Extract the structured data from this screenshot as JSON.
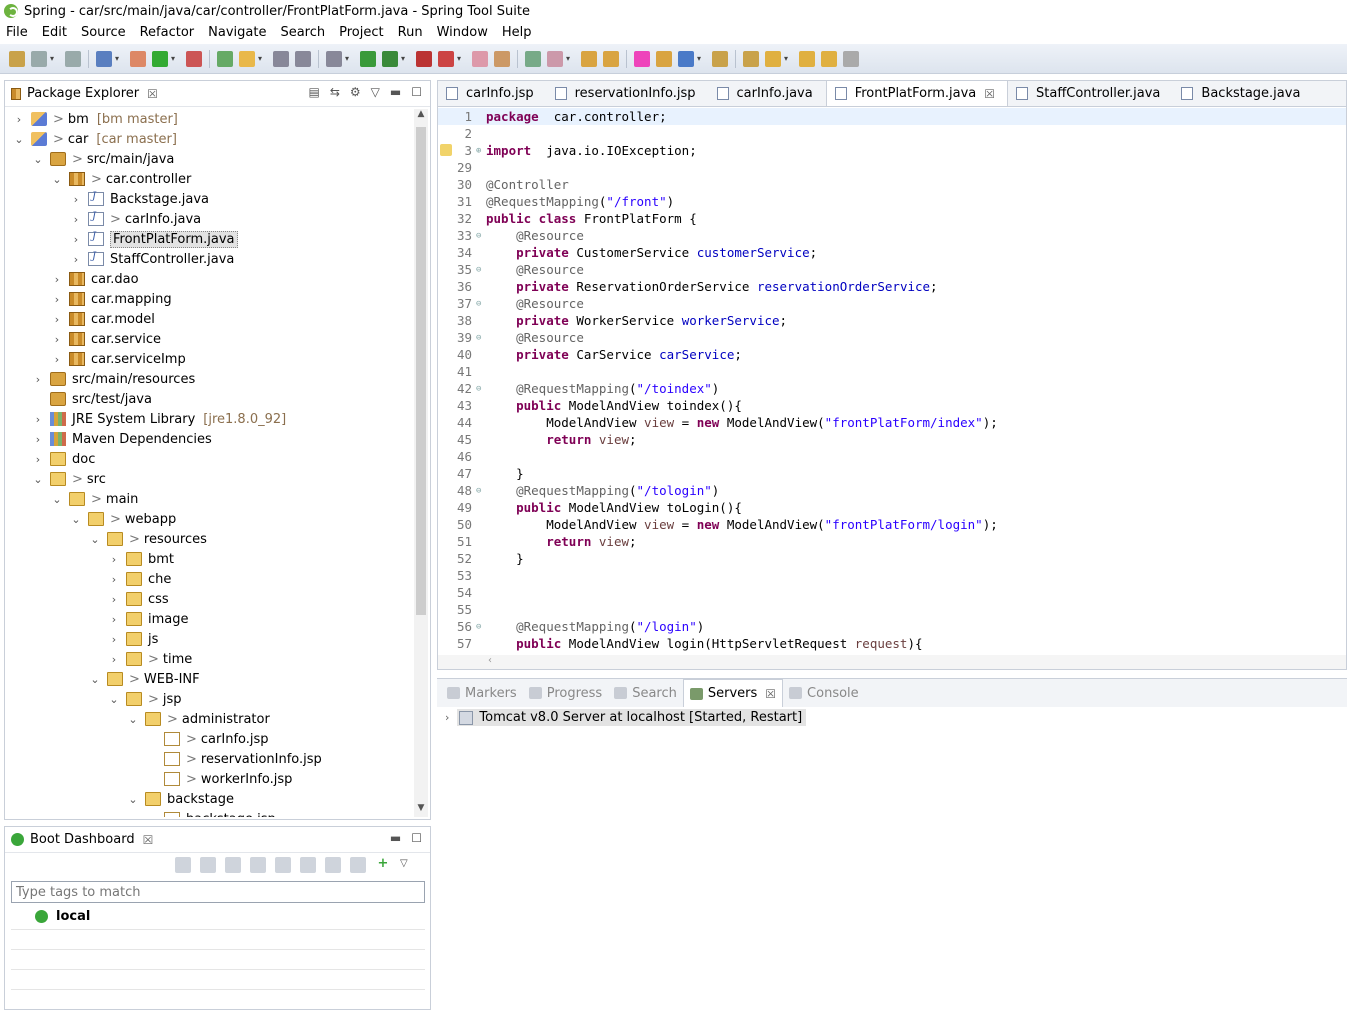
{
  "window": {
    "title": "Spring - car/src/main/java/car/controller/FrontPlatForm.java - Spring Tool Suite"
  },
  "menu": [
    "File",
    "Edit",
    "Source",
    "Refactor",
    "Navigate",
    "Search",
    "Project",
    "Run",
    "Window",
    "Help"
  ],
  "package_explorer": {
    "title": "Package Explorer",
    "close": "☒",
    "tree": [
      {
        "indent": 0,
        "twisty": "›",
        "icon": "proj",
        "prefix": ">",
        "label": "bm",
        "extra": "[bm master]"
      },
      {
        "indent": 0,
        "twisty": "⌄",
        "icon": "proj",
        "prefix": ">",
        "label": "car",
        "extra": "[car master]"
      },
      {
        "indent": 1,
        "twisty": "⌄",
        "icon": "src",
        "prefix": ">",
        "label": "src/main/java",
        "extra": ""
      },
      {
        "indent": 2,
        "twisty": "⌄",
        "icon": "pkg",
        "prefix": ">",
        "label": "car.controller",
        "extra": ""
      },
      {
        "indent": 3,
        "twisty": "›",
        "icon": "java",
        "prefix": "",
        "label": "Backstage.java",
        "extra": ""
      },
      {
        "indent": 3,
        "twisty": "›",
        "icon": "java",
        "prefix": ">",
        "label": "carInfo.java",
        "extra": ""
      },
      {
        "indent": 3,
        "twisty": "›",
        "icon": "java",
        "prefix": "",
        "label": "FrontPlatForm.java",
        "extra": "",
        "selected": true
      },
      {
        "indent": 3,
        "twisty": "›",
        "icon": "java",
        "prefix": "",
        "label": "StaffController.java",
        "extra": ""
      },
      {
        "indent": 2,
        "twisty": "›",
        "icon": "pkg",
        "prefix": "",
        "label": "car.dao",
        "extra": ""
      },
      {
        "indent": 2,
        "twisty": "›",
        "icon": "pkg",
        "prefix": "",
        "label": "car.mapping",
        "extra": ""
      },
      {
        "indent": 2,
        "twisty": "›",
        "icon": "pkg",
        "prefix": "",
        "label": "car.model",
        "extra": ""
      },
      {
        "indent": 2,
        "twisty": "›",
        "icon": "pkg",
        "prefix": "",
        "label": "car.service",
        "extra": ""
      },
      {
        "indent": 2,
        "twisty": "›",
        "icon": "pkg",
        "prefix": "",
        "label": "car.serviceImp",
        "extra": ""
      },
      {
        "indent": 1,
        "twisty": "›",
        "icon": "src",
        "prefix": "",
        "label": "src/main/resources",
        "extra": ""
      },
      {
        "indent": 1,
        "twisty": "",
        "icon": "src",
        "prefix": "",
        "label": "src/test/java",
        "extra": ""
      },
      {
        "indent": 1,
        "twisty": "›",
        "icon": "lib",
        "prefix": "",
        "label": "JRE System Library",
        "extra": "[jre1.8.0_92]"
      },
      {
        "indent": 1,
        "twisty": "›",
        "icon": "lib",
        "prefix": "",
        "label": "Maven Dependencies",
        "extra": ""
      },
      {
        "indent": 1,
        "twisty": "›",
        "icon": "folder",
        "prefix": "",
        "label": "doc",
        "extra": ""
      },
      {
        "indent": 1,
        "twisty": "⌄",
        "icon": "folder",
        "prefix": ">",
        "label": "src",
        "extra": ""
      },
      {
        "indent": 2,
        "twisty": "⌄",
        "icon": "folder",
        "prefix": ">",
        "label": "main",
        "extra": ""
      },
      {
        "indent": 3,
        "twisty": "⌄",
        "icon": "folder",
        "prefix": ">",
        "label": "webapp",
        "extra": ""
      },
      {
        "indent": 4,
        "twisty": "⌄",
        "icon": "folder",
        "prefix": ">",
        "label": "resources",
        "extra": ""
      },
      {
        "indent": 5,
        "twisty": "›",
        "icon": "folder",
        "prefix": "",
        "label": "bmt",
        "extra": ""
      },
      {
        "indent": 5,
        "twisty": "›",
        "icon": "folder",
        "prefix": "",
        "label": "che",
        "extra": ""
      },
      {
        "indent": 5,
        "twisty": "›",
        "icon": "folder",
        "prefix": "",
        "label": "css",
        "extra": ""
      },
      {
        "indent": 5,
        "twisty": "›",
        "icon": "folder",
        "prefix": "",
        "label": "image",
        "extra": ""
      },
      {
        "indent": 5,
        "twisty": "›",
        "icon": "folder",
        "prefix": "",
        "label": "js",
        "extra": ""
      },
      {
        "indent": 5,
        "twisty": "›",
        "icon": "folder",
        "prefix": ">",
        "label": "time",
        "extra": ""
      },
      {
        "indent": 4,
        "twisty": "⌄",
        "icon": "folder",
        "prefix": ">",
        "label": "WEB-INF",
        "extra": ""
      },
      {
        "indent": 5,
        "twisty": "⌄",
        "icon": "folder",
        "prefix": ">",
        "label": "jsp",
        "extra": ""
      },
      {
        "indent": 6,
        "twisty": "⌄",
        "icon": "folder",
        "prefix": ">",
        "label": "administrator",
        "extra": ""
      },
      {
        "indent": 7,
        "twisty": "",
        "icon": "jsp",
        "prefix": ">",
        "label": "carInfo.jsp",
        "extra": ""
      },
      {
        "indent": 7,
        "twisty": "",
        "icon": "jsp",
        "prefix": ">",
        "label": "reservationInfo.jsp",
        "extra": ""
      },
      {
        "indent": 7,
        "twisty": "",
        "icon": "jsp",
        "prefix": ">",
        "label": "workerInfo.jsp",
        "extra": ""
      },
      {
        "indent": 6,
        "twisty": "⌄",
        "icon": "folder",
        "prefix": "",
        "label": "backstage",
        "extra": ""
      },
      {
        "indent": 7,
        "twisty": "",
        "icon": "jsp",
        "prefix": "",
        "label": "backstage.jsp",
        "extra": ""
      }
    ]
  },
  "boot_dashboard": {
    "title": "Boot Dashboard",
    "close": "☒",
    "filter_placeholder": "Type tags to match",
    "local_label": "local"
  },
  "editor": {
    "tabs": [
      {
        "label": "carInfo.jsp",
        "active": false
      },
      {
        "label": "reservationInfo.jsp",
        "active": false
      },
      {
        "label": "carInfo.java",
        "active": false
      },
      {
        "label": "FrontPlatForm.java",
        "active": true
      },
      {
        "label": "StaffController.java",
        "active": false
      },
      {
        "label": "Backstage.java",
        "active": false
      }
    ],
    "close": "☒",
    "lines": [
      {
        "no": "1",
        "fold": "",
        "cur": true,
        "parts": [
          [
            "kw",
            "package"
          ],
          [
            "",
            "  car.controller;"
          ]
        ]
      },
      {
        "no": "2",
        "fold": "",
        "parts": []
      },
      {
        "no": "3",
        "fold": "⊕",
        "parts": [
          [
            "kw",
            "import"
          ],
          [
            "",
            "  java.io.IOException;"
          ]
        ]
      },
      {
        "no": "29",
        "fold": "",
        "parts": []
      },
      {
        "no": "30",
        "fold": "",
        "parts": [
          [
            "an",
            "@Controller"
          ]
        ]
      },
      {
        "no": "31",
        "fold": "",
        "parts": [
          [
            "an",
            "@RequestMapping"
          ],
          [
            "",
            "("
          ],
          [
            "st",
            "\"/front\""
          ],
          [
            "",
            ")"
          ]
        ]
      },
      {
        "no": "32",
        "fold": "",
        "parts": [
          [
            "kw",
            "public class"
          ],
          [
            "",
            " FrontPlatForm {"
          ]
        ]
      },
      {
        "no": "33",
        "fold": "⊖",
        "parts": [
          [
            "",
            "    "
          ],
          [
            "an",
            "@Resource"
          ]
        ]
      },
      {
        "no": "34",
        "fold": "",
        "parts": [
          [
            "",
            "    "
          ],
          [
            "kw",
            "private"
          ],
          [
            "",
            " CustomerService "
          ],
          [
            "fd",
            "customerService"
          ],
          [
            "",
            ";"
          ]
        ]
      },
      {
        "no": "35",
        "fold": "⊖",
        "parts": [
          [
            "",
            "    "
          ],
          [
            "an",
            "@Resource"
          ]
        ]
      },
      {
        "no": "36",
        "fold": "",
        "parts": [
          [
            "",
            "    "
          ],
          [
            "kw",
            "private"
          ],
          [
            "",
            " ReservationOrderService "
          ],
          [
            "fd",
            "reservationOrderService"
          ],
          [
            "",
            ";"
          ]
        ]
      },
      {
        "no": "37",
        "fold": "⊖",
        "parts": [
          [
            "",
            "    "
          ],
          [
            "an",
            "@Resource"
          ]
        ]
      },
      {
        "no": "38",
        "fold": "",
        "parts": [
          [
            "",
            "    "
          ],
          [
            "kw",
            "private"
          ],
          [
            "",
            " WorkerService "
          ],
          [
            "fd",
            "workerService"
          ],
          [
            "",
            ";"
          ]
        ]
      },
      {
        "no": "39",
        "fold": "⊖",
        "parts": [
          [
            "",
            "    "
          ],
          [
            "an",
            "@Resource"
          ]
        ]
      },
      {
        "no": "40",
        "fold": "",
        "parts": [
          [
            "",
            "    "
          ],
          [
            "kw",
            "private"
          ],
          [
            "",
            " CarService "
          ],
          [
            "fd",
            "carService"
          ],
          [
            "",
            ";"
          ]
        ]
      },
      {
        "no": "41",
        "fold": "",
        "parts": []
      },
      {
        "no": "42",
        "fold": "⊖",
        "parts": [
          [
            "",
            "    "
          ],
          [
            "an",
            "@RequestMapping"
          ],
          [
            "",
            "("
          ],
          [
            "st",
            "\"/toindex\""
          ],
          [
            "",
            ")"
          ]
        ]
      },
      {
        "no": "43",
        "fold": "",
        "parts": [
          [
            "",
            "    "
          ],
          [
            "kw",
            "public"
          ],
          [
            "",
            " ModelAndView toindex(){"
          ]
        ]
      },
      {
        "no": "44",
        "fold": "",
        "parts": [
          [
            "",
            "        ModelAndView "
          ],
          [
            "pm",
            "view"
          ],
          [
            "",
            " = "
          ],
          [
            "kw",
            "new"
          ],
          [
            "",
            " ModelAndView("
          ],
          [
            "st",
            "\"frontPlatForm/index\""
          ],
          [
            "",
            ");"
          ]
        ]
      },
      {
        "no": "45",
        "fold": "",
        "parts": [
          [
            "",
            "        "
          ],
          [
            "kw",
            "return"
          ],
          [
            "",
            " "
          ],
          [
            "pm",
            "view"
          ],
          [
            "",
            ";"
          ]
        ]
      },
      {
        "no": "46",
        "fold": "",
        "parts": []
      },
      {
        "no": "47",
        "fold": "",
        "parts": [
          [
            "",
            "    }"
          ]
        ]
      },
      {
        "no": "48",
        "fold": "⊖",
        "parts": [
          [
            "",
            "    "
          ],
          [
            "an",
            "@RequestMapping"
          ],
          [
            "",
            "("
          ],
          [
            "st",
            "\"/tologin\""
          ],
          [
            "",
            ")"
          ]
        ]
      },
      {
        "no": "49",
        "fold": "",
        "parts": [
          [
            "",
            "    "
          ],
          [
            "kw",
            "public"
          ],
          [
            "",
            " ModelAndView toLogin(){"
          ]
        ]
      },
      {
        "no": "50",
        "fold": "",
        "parts": [
          [
            "",
            "        ModelAndView "
          ],
          [
            "pm",
            "view"
          ],
          [
            "",
            " = "
          ],
          [
            "kw",
            "new"
          ],
          [
            "",
            " ModelAndView("
          ],
          [
            "st",
            "\"frontPlatForm/login\""
          ],
          [
            "",
            ");"
          ]
        ]
      },
      {
        "no": "51",
        "fold": "",
        "parts": [
          [
            "",
            "        "
          ],
          [
            "kw",
            "return"
          ],
          [
            "",
            " "
          ],
          [
            "pm",
            "view"
          ],
          [
            "",
            ";"
          ]
        ]
      },
      {
        "no": "52",
        "fold": "",
        "parts": [
          [
            "",
            "    }"
          ]
        ]
      },
      {
        "no": "53",
        "fold": "",
        "parts": []
      },
      {
        "no": "54",
        "fold": "",
        "parts": []
      },
      {
        "no": "55",
        "fold": "",
        "parts": []
      },
      {
        "no": "56",
        "fold": "⊖",
        "parts": [
          [
            "",
            "    "
          ],
          [
            "an",
            "@RequestMapping"
          ],
          [
            "",
            "("
          ],
          [
            "st",
            "\"/login\""
          ],
          [
            "",
            ")"
          ]
        ]
      },
      {
        "no": "57",
        "fold": "",
        "parts": [
          [
            "",
            "    "
          ],
          [
            "kw",
            "public"
          ],
          [
            "",
            " ModelAndView login(HttpServletRequest "
          ],
          [
            "pm",
            "request"
          ],
          [
            "",
            "){"
          ]
        ]
      }
    ]
  },
  "bottom_panel": {
    "tabs": [
      {
        "label": "Markers",
        "active": false
      },
      {
        "label": "Progress",
        "active": false
      },
      {
        "label": "Search",
        "active": false
      },
      {
        "label": "Servers",
        "active": true
      },
      {
        "label": "Console",
        "active": false
      }
    ],
    "close": "☒",
    "server_row": "Tomcat v8.0 Server at localhost  [Started, Restart]"
  }
}
